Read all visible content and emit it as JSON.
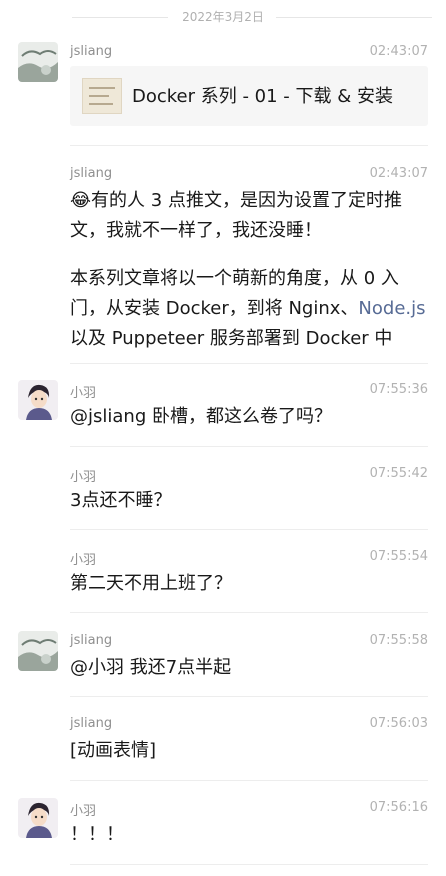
{
  "date_separator": "2022年3月2日",
  "colors": {
    "link": "#576b95",
    "divider": "#ededed",
    "meta_text": "#b2b2b2"
  },
  "messages": [
    {
      "sender": "jsliang",
      "time": "02:43:07",
      "card_title": "Docker 系列 - 01 - 下载 & 安装"
    },
    {
      "sender": "jsliang",
      "time": "02:43:07",
      "emoji": "😂",
      "p1": "有的人 3 点推文，是因为设置了定时推文，我就不一样了，我还没睡！",
      "p2_before": "本系列文章将以一个萌新的角度，从 0 入门，从安装 Docker，到将 Nginx、",
      "p2_link": "Node.js",
      "p2_after": "以及 Puppeteer 服务部署到 Docker 中"
    },
    {
      "sender": "小羽",
      "time": "07:55:36",
      "text": "@jsliang 卧槽，都这么卷了吗？"
    },
    {
      "sender": "小羽",
      "time": "07:55:42",
      "text": "3点还不睡？"
    },
    {
      "sender": "小羽",
      "time": "07:55:54",
      "text": "第二天不用上班了？"
    },
    {
      "sender": "jsliang",
      "time": "07:55:58",
      "text": "@小羽 我还7点半起"
    },
    {
      "sender": "jsliang",
      "time": "07:56:03",
      "text": "[动画表情]"
    },
    {
      "sender": "小羽",
      "time": "07:56:16",
      "text": "！！！"
    }
  ]
}
